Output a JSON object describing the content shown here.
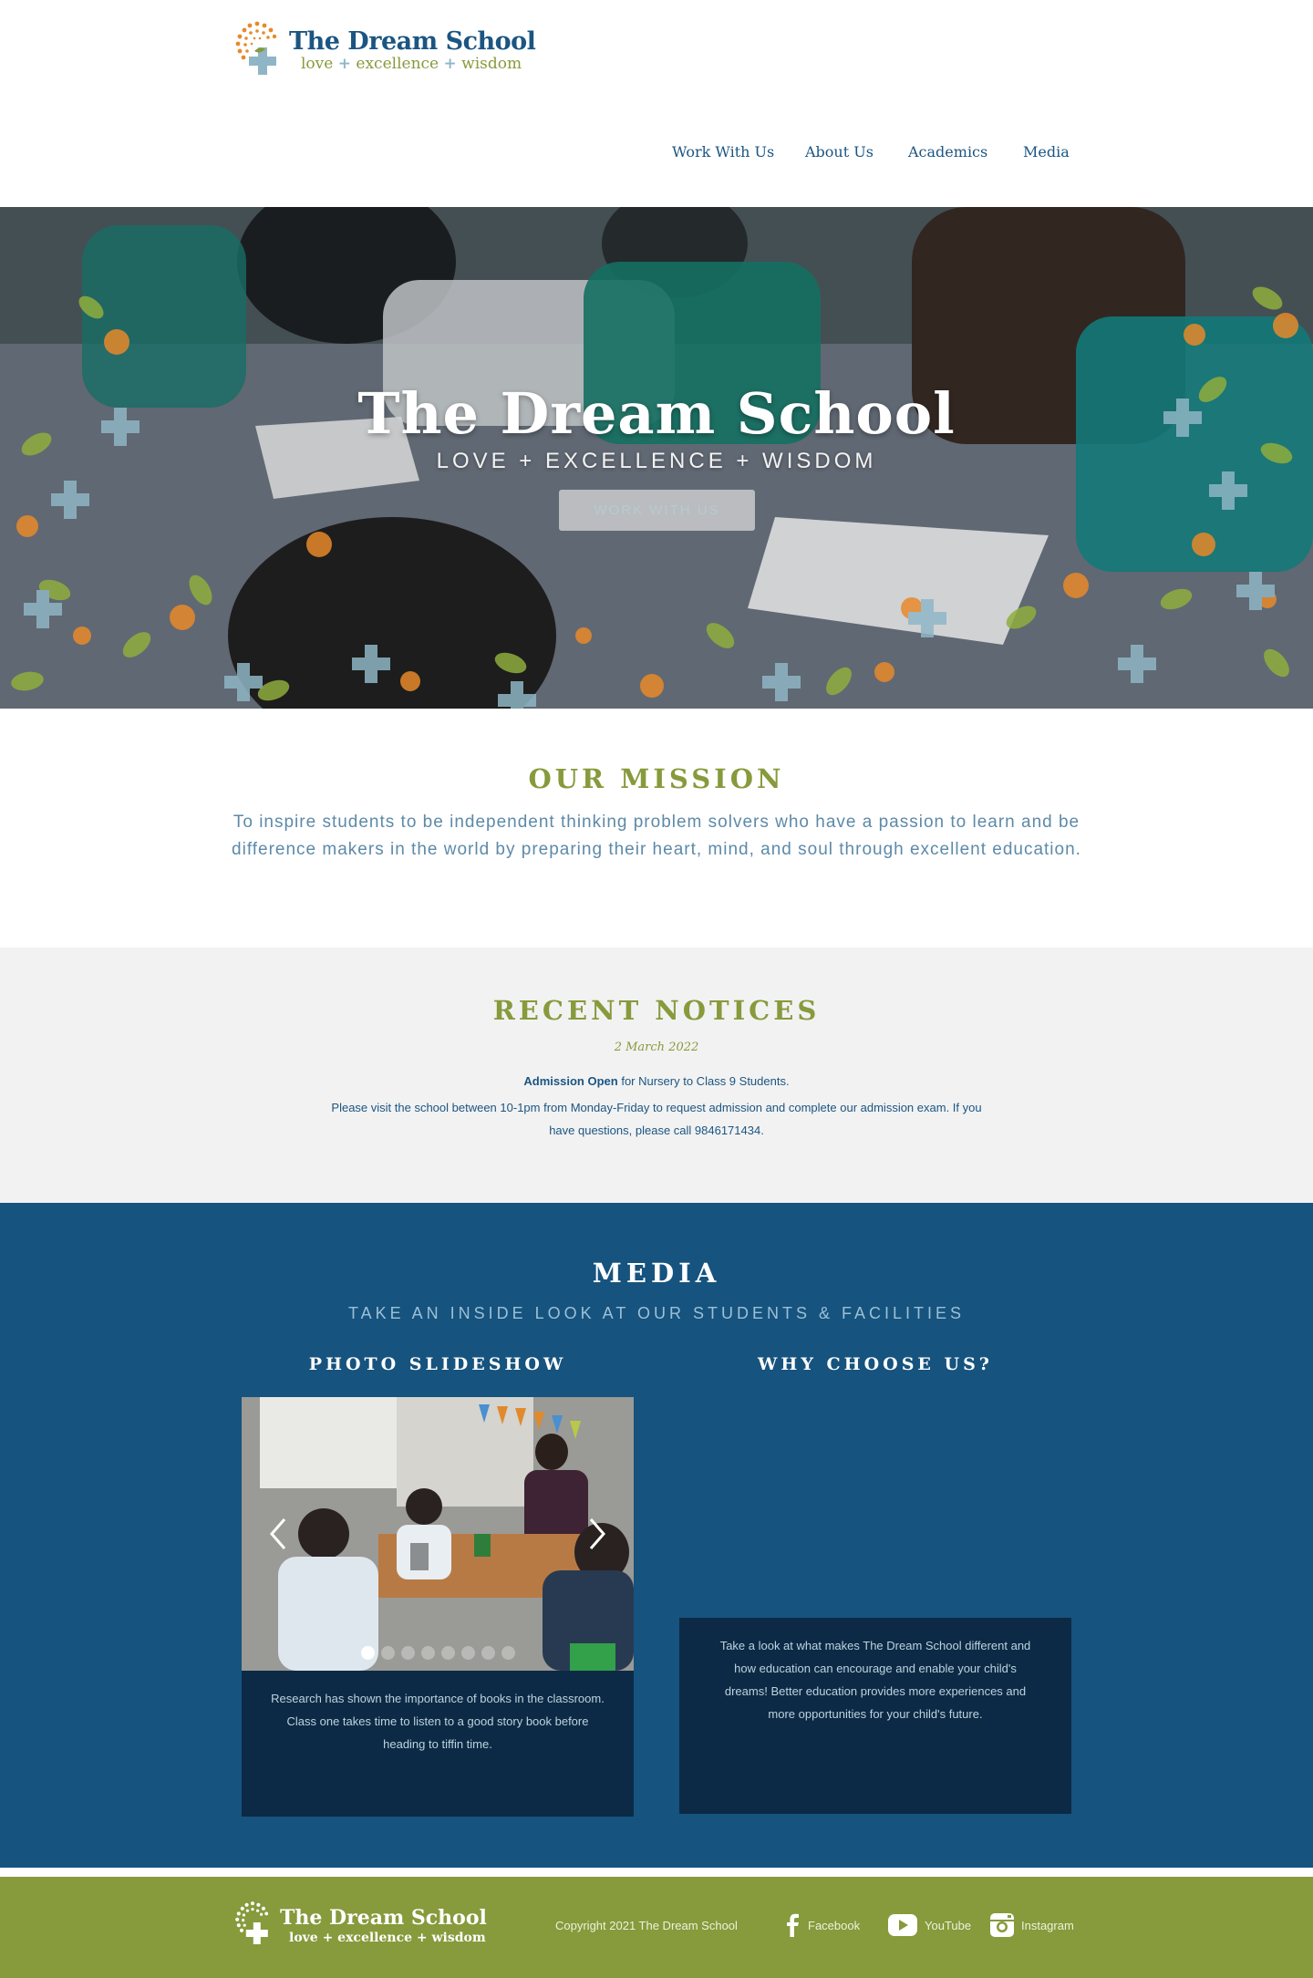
{
  "header": {
    "logo_title": "The Dream School",
    "logo_tagline": [
      "love",
      "excellence",
      "wisdom"
    ],
    "nav": [
      "Work With Us",
      "About Us",
      "Academics",
      "Media"
    ]
  },
  "hero": {
    "title": "The Dream School",
    "subtitle": "LOVE + EXCELLENCE + WISDOM",
    "button_label": "WORK WITH US"
  },
  "mission": {
    "heading": "OUR MISSION",
    "text": "To inspire students to be independent thinking problem solvers who have a passion to learn and be difference makers in the world by preparing their heart, mind, and soul through excellent education."
  },
  "notices": {
    "heading": "RECENT NOTICES",
    "date": "2 March 2022",
    "highlight": "Admission Open",
    "highlight_rest": " for Nursery to Class 9 Students.",
    "body": "Please visit the school between 10-1pm from Monday-Friday to request admission and complete our admission exam. If you have questions, please call 9846171434."
  },
  "media": {
    "heading": "MEDIA",
    "subheading": "TAKE AN INSIDE LOOK AT OUR STUDENTS & FACILITIES",
    "slideshow_heading": "PHOTO SLIDESHOW",
    "slideshow_caption": "Research has shown the importance of books in the classroom. Class one takes time to listen to a good story book before heading to tiffin time.",
    "slide_count": 8,
    "active_slide": 1,
    "why_heading": "WHY CHOOSE US?",
    "why_text": "Take a look at what makes The Dream School different and how education can encourage and enable your child's dreams! Better education provides more experiences and more opportunities for your child's future."
  },
  "footer": {
    "logo_title": "The Dream School",
    "logo_tagline": "love + excellence + wisdom",
    "copyright": "Copyright 2021 The Dream School",
    "social": [
      {
        "label": "Facebook",
        "icon": "facebook-icon"
      },
      {
        "label": "YouTube",
        "icon": "youtube-icon"
      },
      {
        "label": "Instagram",
        "icon": "instagram-icon"
      }
    ]
  },
  "colors": {
    "navy": "#1b5582",
    "olive": "#879a3c",
    "media_bg": "#16537e",
    "dark_box": "#0c2a45",
    "notices_bg": "#f2f2f2",
    "orange": "#e8892a",
    "light_blue": "#8fb6c6"
  }
}
